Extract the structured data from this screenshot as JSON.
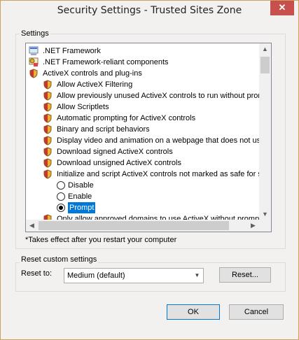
{
  "window": {
    "title": "Security Settings - Trusted Sites Zone",
    "close_glyph": "✕"
  },
  "settings": {
    "group_label": "Settings",
    "tree": [
      {
        "label": ".NET Framework",
        "icon": "dotnet-icon"
      },
      {
        "label": ".NET Framework-reliant components",
        "icon": "dotnet-components-icon"
      },
      {
        "label": "ActiveX controls and plug-ins",
        "icon": "security-shield-icon"
      },
      {
        "label": "Allow ActiveX Filtering",
        "icon": "security-shield-icon"
      },
      {
        "label": "Allow previously unused ActiveX controls to run without prom",
        "icon": "security-shield-icon"
      },
      {
        "label": "Allow Scriptlets",
        "icon": "security-shield-icon"
      },
      {
        "label": "Automatic prompting for ActiveX controls",
        "icon": "security-shield-icon"
      },
      {
        "label": "Binary and script behaviors",
        "icon": "security-shield-icon"
      },
      {
        "label": "Display video and animation on a webpage that does not use",
        "icon": "security-shield-icon"
      },
      {
        "label": "Download signed ActiveX controls",
        "icon": "security-shield-icon"
      },
      {
        "label": "Download unsigned ActiveX controls",
        "icon": "security-shield-icon"
      },
      {
        "label": "Initialize and script ActiveX controls not marked as safe for sc",
        "icon": "security-shield-icon"
      },
      {
        "label": "Only allow approved domains to use ActiveX without prompt",
        "icon": "security-shield-icon"
      }
    ],
    "options": {
      "disable": "Disable",
      "enable": "Enable",
      "prompt": "Prompt",
      "selected": "Prompt"
    },
    "note": "*Takes effect after you restart your computer"
  },
  "reset": {
    "group_label": "Reset custom settings",
    "reset_to_label": "Reset to:",
    "level_value": "Medium (default)",
    "reset_button": "Reset..."
  },
  "footer": {
    "ok": "OK",
    "cancel": "Cancel"
  },
  "colors": {
    "selection": "#0078d7",
    "close": "#c7504c",
    "shield_gold": "#e8b23a",
    "shield_red": "#c0392b"
  }
}
